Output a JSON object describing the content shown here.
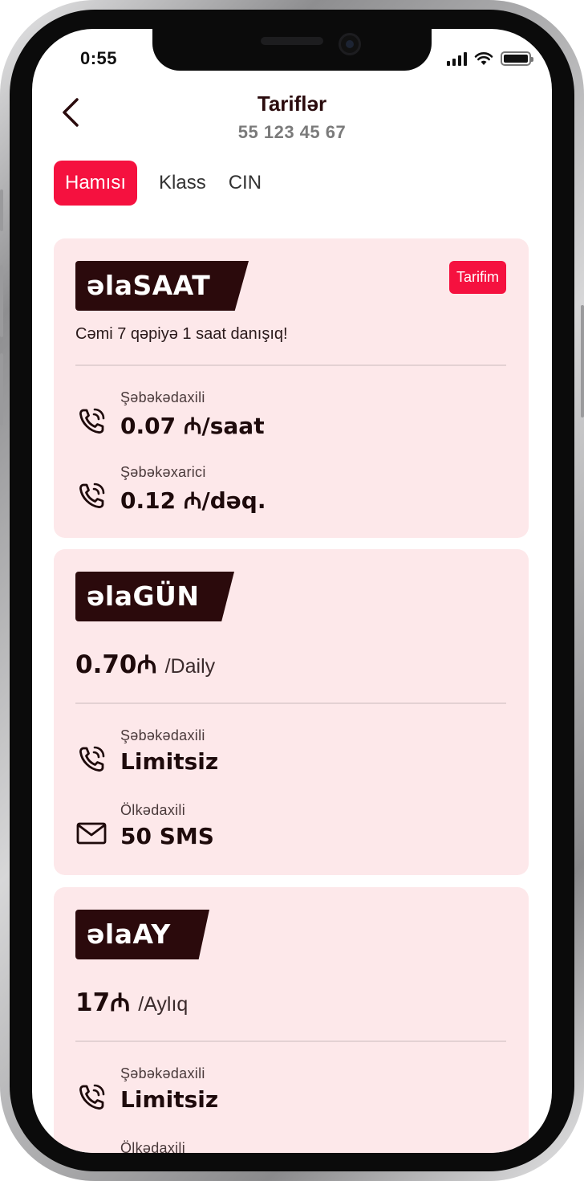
{
  "status_bar": {
    "time": "0:55"
  },
  "header": {
    "title": "Tariflər",
    "subtitle": "55 123 45 67"
  },
  "tabs": [
    {
      "label": "Hamısı",
      "active": true
    },
    {
      "label": "Klass",
      "active": false
    },
    {
      "label": "CIN",
      "active": false
    }
  ],
  "tariffs": [
    {
      "name": "əlaSAAT",
      "tag": "Tarifim",
      "description": "Cəmi 7 qəpiyə 1 saat danışıq!",
      "features": [
        {
          "icon": "phone-call-icon",
          "label": "Şəbəkədaxili",
          "value": "0.07 ₼/saat"
        },
        {
          "icon": "phone-call-icon",
          "label": "Şəbəkəxarici",
          "value": "0.12 ₼/dəq."
        }
      ]
    },
    {
      "name": "əlaGÜN",
      "price": "0.70₼",
      "period": "/Daily",
      "features": [
        {
          "icon": "phone-call-icon",
          "label": "Şəbəkədaxili",
          "value": "Limitsiz"
        },
        {
          "icon": "mail-icon",
          "label": "Ölkədaxili",
          "value": "50 SMS"
        }
      ]
    },
    {
      "name": "əlaAY",
      "price": "17₼",
      "period": "/Aylıq",
      "features": [
        {
          "icon": "phone-call-icon",
          "label": "Şəbəkədaxili",
          "value": "Limitsiz"
        },
        {
          "icon": "mail-icon",
          "label": "Ölkədaxili",
          "value": ""
        }
      ]
    }
  ],
  "colors": {
    "accent": "#f5113f",
    "card_bg": "#fde8ea",
    "badge_bg": "#2b0a0c",
    "text_dark": "#1e0a0b"
  }
}
